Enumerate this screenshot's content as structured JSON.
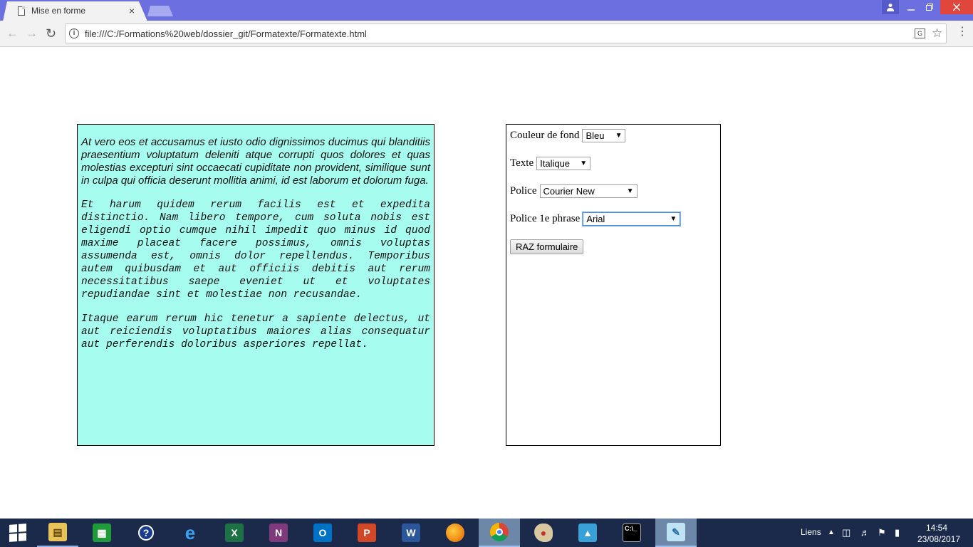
{
  "browser": {
    "tab_title": "Mise en forme",
    "tab_close": "×",
    "url": "file:///C:/Formations%20web/dossier_git/Formatexte/Formatexte.html",
    "icons": [
      "page-icon",
      "back-icon",
      "forward-icon",
      "reload-icon",
      "info-icon",
      "translate-icon",
      "star-icon",
      "menu-icon",
      "user-icon",
      "minimize-icon",
      "restore-icon",
      "close-icon"
    ]
  },
  "text_box": {
    "background": "#a7fcf0",
    "paragraphs": [
      "At vero eos et accusamus et iusto odio dignissimos ducimus qui blanditiis praesentium voluptatum deleniti atque corrupti quos dolores et quas molestias excepturi sint occaecati cupiditate non provident, similique sunt in culpa qui officia deserunt mollitia animi, id est laborum et dolorum fuga.",
      "Et harum quidem rerum facilis est et expedita distinctio. Nam libero tempore, cum soluta nobis est eligendi optio cumque nihil impedit quo minus id quod maxime placeat facere possimus, omnis voluptas assumenda est, omnis dolor repellendus. Temporibus autem quibusdam et aut officiis debitis aut rerum necessitatibus saepe eveniet ut et voluptates repudiandae sint et molestiae non recusandae.",
      "Itaque earum rerum hic tenetur a sapiente delectus, ut aut reiciendis voluptatibus maiores alias consequatur aut perferendis doloribus asperiores repellat."
    ]
  },
  "form": {
    "background_label": "Couleur de fond",
    "background_value": "Bleu",
    "text_label": "Texte",
    "text_value": "Italique",
    "font_label": "Police",
    "font_value": "Courier New",
    "first_sentence_label": "Police 1e phrase",
    "first_sentence_value": "Arial",
    "reset_label": "RAZ formulaire"
  },
  "taskbar": {
    "apps": [
      "file-explorer-icon",
      "store-icon",
      "help-icon",
      "internet-explorer-icon",
      "excel-icon",
      "onenote-icon",
      "outlook-icon",
      "powerpoint-icon",
      "word-icon",
      "firefox-icon",
      "chrome-icon",
      "paint-icon",
      "installer-icon",
      "command-prompt-icon",
      "notepad-icon"
    ],
    "links_label": "Liens",
    "time": "14:54",
    "date": "23/08/2017"
  }
}
